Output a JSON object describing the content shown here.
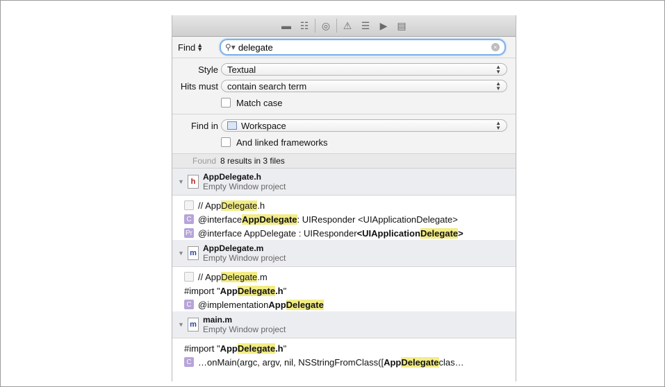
{
  "toolbar": {
    "icons": [
      "folder-icon",
      "hierarchy-icon",
      "symbol-icon",
      "warning-icon",
      "list-icon",
      "breakpoint-icon",
      "log-icon"
    ]
  },
  "find": {
    "label": "Find",
    "query": "delegate"
  },
  "options": {
    "style_label": "Style",
    "style_value": "Textual",
    "hits_label": "Hits must",
    "hits_value": "contain search term",
    "match_case_label": "Match case",
    "findin_label": "Find in",
    "findin_value": "Workspace",
    "linked_label": "And linked frameworks"
  },
  "status": {
    "found_label": "Found",
    "summary": "8 results in 3 files"
  },
  "groups": [
    {
      "file": "AppDelegate.h",
      "icon_letter": "h",
      "project": "Empty Window project",
      "results": [
        {
          "icon": "file",
          "segments": [
            [
              "// App",
              ""
            ],
            [
              "Delegate",
              "hl"
            ],
            [
              ".h",
              ""
            ]
          ]
        },
        {
          "icon": "C",
          "segments": [
            [
              "@interface ",
              ""
            ],
            [
              "AppDelegate",
              "b hl"
            ],
            [
              " : UIResponder <UIApplicationDelegate>",
              ""
            ]
          ]
        },
        {
          "icon": "Pr",
          "segments": [
            [
              "@interface AppDelegate : UIResponder ",
              ""
            ],
            [
              "<UIApplication",
              "b"
            ],
            [
              "Delegate",
              "b hl"
            ],
            [
              ">",
              "b"
            ]
          ]
        }
      ]
    },
    {
      "file": "AppDelegate.m",
      "icon_letter": "m",
      "project": "Empty Window project",
      "results": [
        {
          "icon": "file",
          "segments": [
            [
              "// App",
              ""
            ],
            [
              "Delegate",
              "hl"
            ],
            [
              ".m",
              ""
            ]
          ]
        },
        {
          "icon": "none",
          "segments": [
            [
              "#import \"",
              ""
            ],
            [
              "App",
              "b"
            ],
            [
              "Delegate",
              "b hl"
            ],
            [
              ".h",
              "b"
            ],
            [
              "\"",
              ""
            ]
          ]
        },
        {
          "icon": "C",
          "segments": [
            [
              "@implementation ",
              ""
            ],
            [
              "App",
              "b"
            ],
            [
              "Delegate",
              "b hl"
            ]
          ]
        }
      ]
    },
    {
      "file": "main.m",
      "icon_letter": "m",
      "project": "Empty Window project",
      "results": [
        {
          "icon": "none",
          "segments": [
            [
              "#import \"",
              ""
            ],
            [
              "App",
              "b"
            ],
            [
              "Delegate",
              "b hl"
            ],
            [
              ".h",
              "b"
            ],
            [
              "\"",
              ""
            ]
          ]
        },
        {
          "icon": "C",
          "segments": [
            [
              "…onMain(argc, argv, nil, NSStringFromClass([",
              ""
            ],
            [
              "App",
              "b"
            ],
            [
              "Delegate",
              "b hl"
            ],
            [
              " clas…",
              ""
            ]
          ]
        }
      ]
    }
  ]
}
